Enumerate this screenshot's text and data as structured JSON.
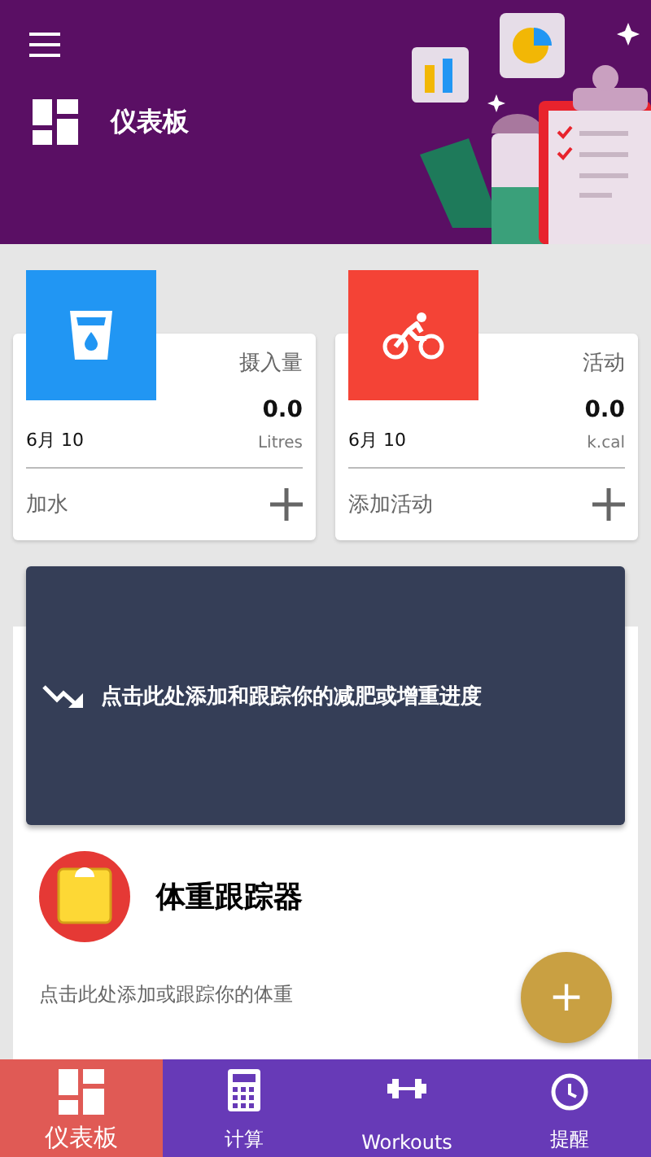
{
  "header": {
    "title": "仪表板"
  },
  "stats": [
    {
      "kind": "water",
      "label": "摄入量",
      "value": "0.0",
      "unit": "Litres",
      "date": "6月 10",
      "action": "加水",
      "color": "#2196f3"
    },
    {
      "kind": "activity",
      "label": "活动",
      "value": "0.0",
      "unit": "k.cal",
      "date": "6月 10",
      "action": "添加活动",
      "color": "#f44336"
    }
  ],
  "progress_banner": {
    "text": "点击此处添加和跟踪你的减肥或增重进度"
  },
  "weight_tracker": {
    "title": "体重跟踪器",
    "hint": "点击此处添加或跟踪你的体重"
  },
  "fab": {
    "label": "+"
  },
  "nav": [
    {
      "kind": "dashboard",
      "label": "仪表板",
      "selected": true
    },
    {
      "kind": "calculator",
      "label": "计算",
      "selected": false
    },
    {
      "kind": "workouts",
      "label": "Workouts",
      "selected": false
    },
    {
      "kind": "reminder",
      "label": "提醒",
      "selected": false
    }
  ]
}
